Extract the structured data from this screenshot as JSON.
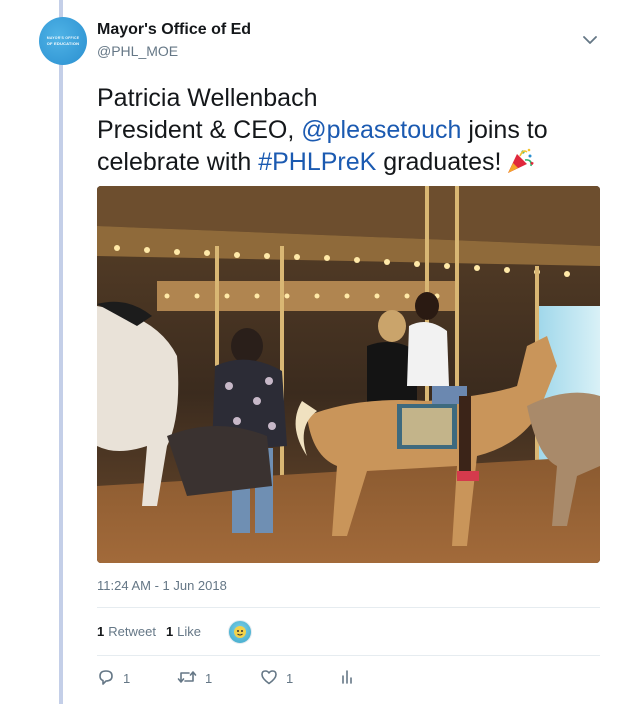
{
  "author": {
    "name": "Mayor's Office of Ed",
    "handle": "@PHL_MOE",
    "avatar_text_line1": "MAYOR'S OFFICE",
    "avatar_text_line2": "OF EDUCATION"
  },
  "tweet": {
    "line1": "Patricia Wellenbach",
    "line2_prefix": "President & CEO, ",
    "mention": "@pleasetouch",
    "line2_suffix": " joins to",
    "line3_prefix": "celebrate with ",
    "hashtag": "#PHLPreK",
    "line3_suffix": " graduates!",
    "emoji_icon": "party-popper-icon"
  },
  "timestamp": "11:24 AM - 1 Jun 2018",
  "stats": {
    "retweets_count": "1",
    "retweets_label": "Retweet",
    "likes_count": "1",
    "likes_label": "Like"
  },
  "actions": {
    "reply_count": "1",
    "retweet_count": "1",
    "like_count": "1"
  },
  "colors": {
    "link": "#1b5ab1",
    "thread_line": "#c4cfe8",
    "muted": "#657786"
  }
}
